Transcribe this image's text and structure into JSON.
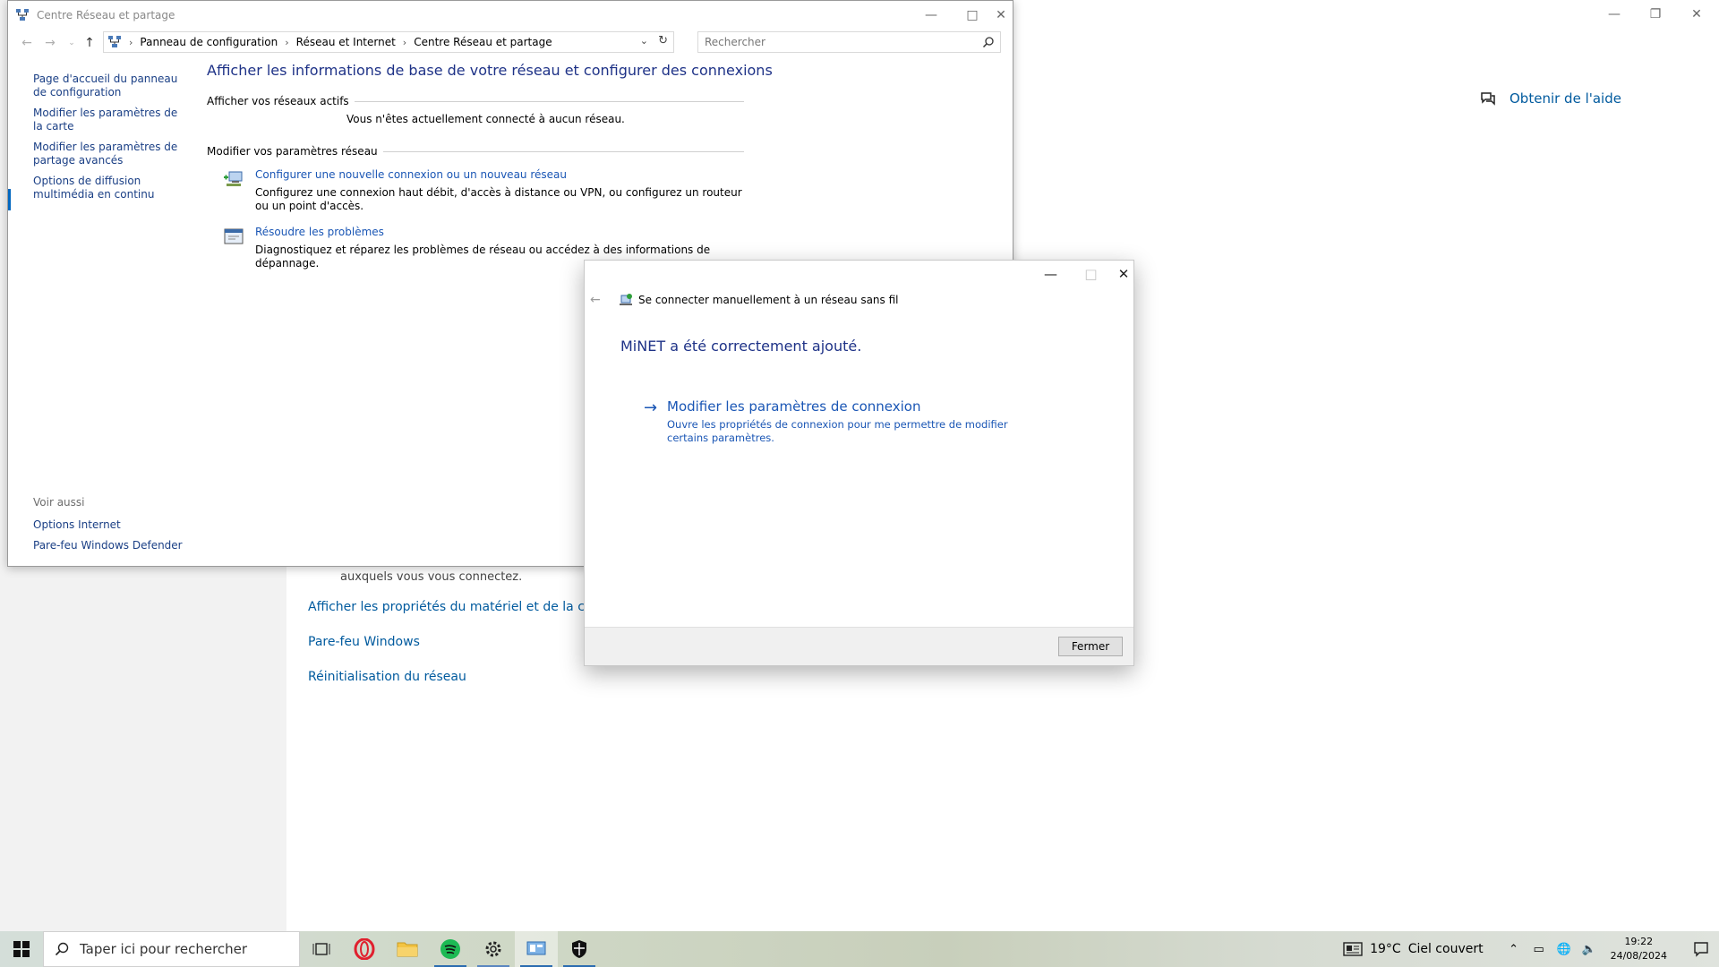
{
  "settings": {
    "help_label": "Obtenir de l'aide",
    "partial_text": "auxquels vous vous connectez.",
    "links": [
      "Afficher les propriétés du matériel et de la connexion",
      "Pare-feu Windows",
      "Réinitialisation du réseau"
    ]
  },
  "control_panel": {
    "title": "Centre Réseau et partage",
    "breadcrumbs": [
      "Panneau de configuration",
      "Réseau et Internet",
      "Centre Réseau et partage"
    ],
    "search_placeholder": "Rechercher",
    "left_links": [
      "Page d'accueil du panneau de configuration",
      "Modifier les paramètres de la carte",
      "Modifier les paramètres de partage avancés",
      "Options de diffusion multimédia en continu"
    ],
    "see_also_heading": "Voir aussi",
    "see_also_links": [
      "Options Internet",
      "Pare-feu Windows Defender"
    ],
    "heading": "Afficher les informations de base de votre réseau et configurer des connexions",
    "active_networks_heading": "Afficher vos réseaux actifs",
    "no_network_text": "Vous n'êtes actuellement connecté à aucun réseau.",
    "modify_heading": "Modifier vos paramètres réseau",
    "tasks": [
      {
        "link": "Configurer une nouvelle connexion ou un nouveau réseau",
        "desc": "Configurez une connexion haut débit, d'accès à distance ou VPN, ou configurez un routeur ou un point d'accès."
      },
      {
        "link": "Résoudre les problèmes",
        "desc": "Diagnostiquez et réparez les problèmes de réseau ou accédez à des informations de dépannage."
      }
    ]
  },
  "dialog": {
    "title": "Se connecter manuellement à un réseau sans fil",
    "success_message": "MiNET a été correctement ajouté.",
    "action_title": "Modifier les paramètres de connexion",
    "action_desc": "Ouvre les propriétés de connexion pour me permettre de modifier certains paramètres.",
    "close_label": "Fermer"
  },
  "taskbar": {
    "search_placeholder": "Taper ici pour rechercher",
    "weather_temp": "19°C",
    "weather_desc": "Ciel couvert",
    "time": "19:22",
    "date": "24/08/2024",
    "icons": [
      "task-view-icon",
      "opera-icon",
      "file-explorer-icon",
      "spotify-icon",
      "settings-icon",
      "control-panel-icon",
      "security-icon"
    ]
  },
  "colors": {
    "link_blue": "#1a56b5",
    "heading_blue": "#1e3287",
    "settings_link": "#005a9e"
  }
}
